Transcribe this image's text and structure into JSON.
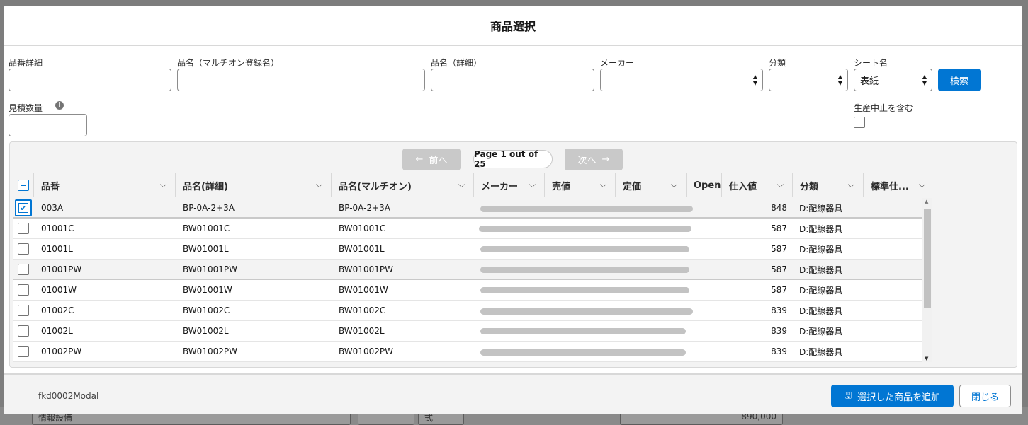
{
  "background": {
    "field_1": "情報設備",
    "field_2": "式",
    "field_3": "890,000"
  },
  "modal": {
    "title": "商品選択",
    "filters": {
      "part_detail_label": "品番詳細",
      "name_multi_label": "品名（マルチオン登録名）",
      "name_detail_label": "品名（詳細）",
      "maker_label": "メーカー",
      "category_label": "分類",
      "sheet_label": "シート名",
      "sheet_value": "表紙",
      "search_button": "検索",
      "quantity_label": "見積数量",
      "discontinued_label": "生産中止を含む"
    },
    "pager": {
      "prev": "前へ",
      "indicator": "Page 1 out of 25",
      "next": "次へ"
    },
    "columns": [
      "品番",
      "品名(詳細)",
      "品名(マルチオン)",
      "メーカー",
      "売値",
      "定価",
      "Open",
      "仕入値",
      "分類",
      "標準仕..."
    ],
    "rows": [
      {
        "code": "003A",
        "name_detail": "BP-0A-2+3A",
        "name_multi": "BP-0A-2+3A",
        "cost": "848",
        "category": "D:配線器具",
        "checked": true
      },
      {
        "code": "01001C",
        "name_detail": "BW01001C",
        "name_multi": "BW01001C",
        "cost": "587",
        "category": "D:配線器具",
        "checked": false
      },
      {
        "code": "01001L",
        "name_detail": "BW01001L",
        "name_multi": "BW01001L",
        "cost": "587",
        "category": "D:配線器具",
        "checked": false
      },
      {
        "code": "01001PW",
        "name_detail": "BW01001PW",
        "name_multi": "BW01001PW",
        "cost": "587",
        "category": "D:配線器具",
        "checked": false
      },
      {
        "code": "01001W",
        "name_detail": "BW01001W",
        "name_multi": "BW01001W",
        "cost": "587",
        "category": "D:配線器具",
        "checked": false
      },
      {
        "code": "01002C",
        "name_detail": "BW01002C",
        "name_multi": "BW01002C",
        "cost": "839",
        "category": "D:配線器具",
        "checked": false
      },
      {
        "code": "01002L",
        "name_detail": "BW01002L",
        "name_multi": "BW01002L",
        "cost": "839",
        "category": "D:配線器具",
        "checked": false
      },
      {
        "code": "01002PW",
        "name_detail": "BW01002PW",
        "name_multi": "BW01002PW",
        "cost": "839",
        "category": "D:配線器具",
        "checked": false
      }
    ],
    "footer": {
      "component_name": "fkd0002Modal",
      "add_button": "選択した商品を追加",
      "close_button": "閉じる"
    }
  }
}
